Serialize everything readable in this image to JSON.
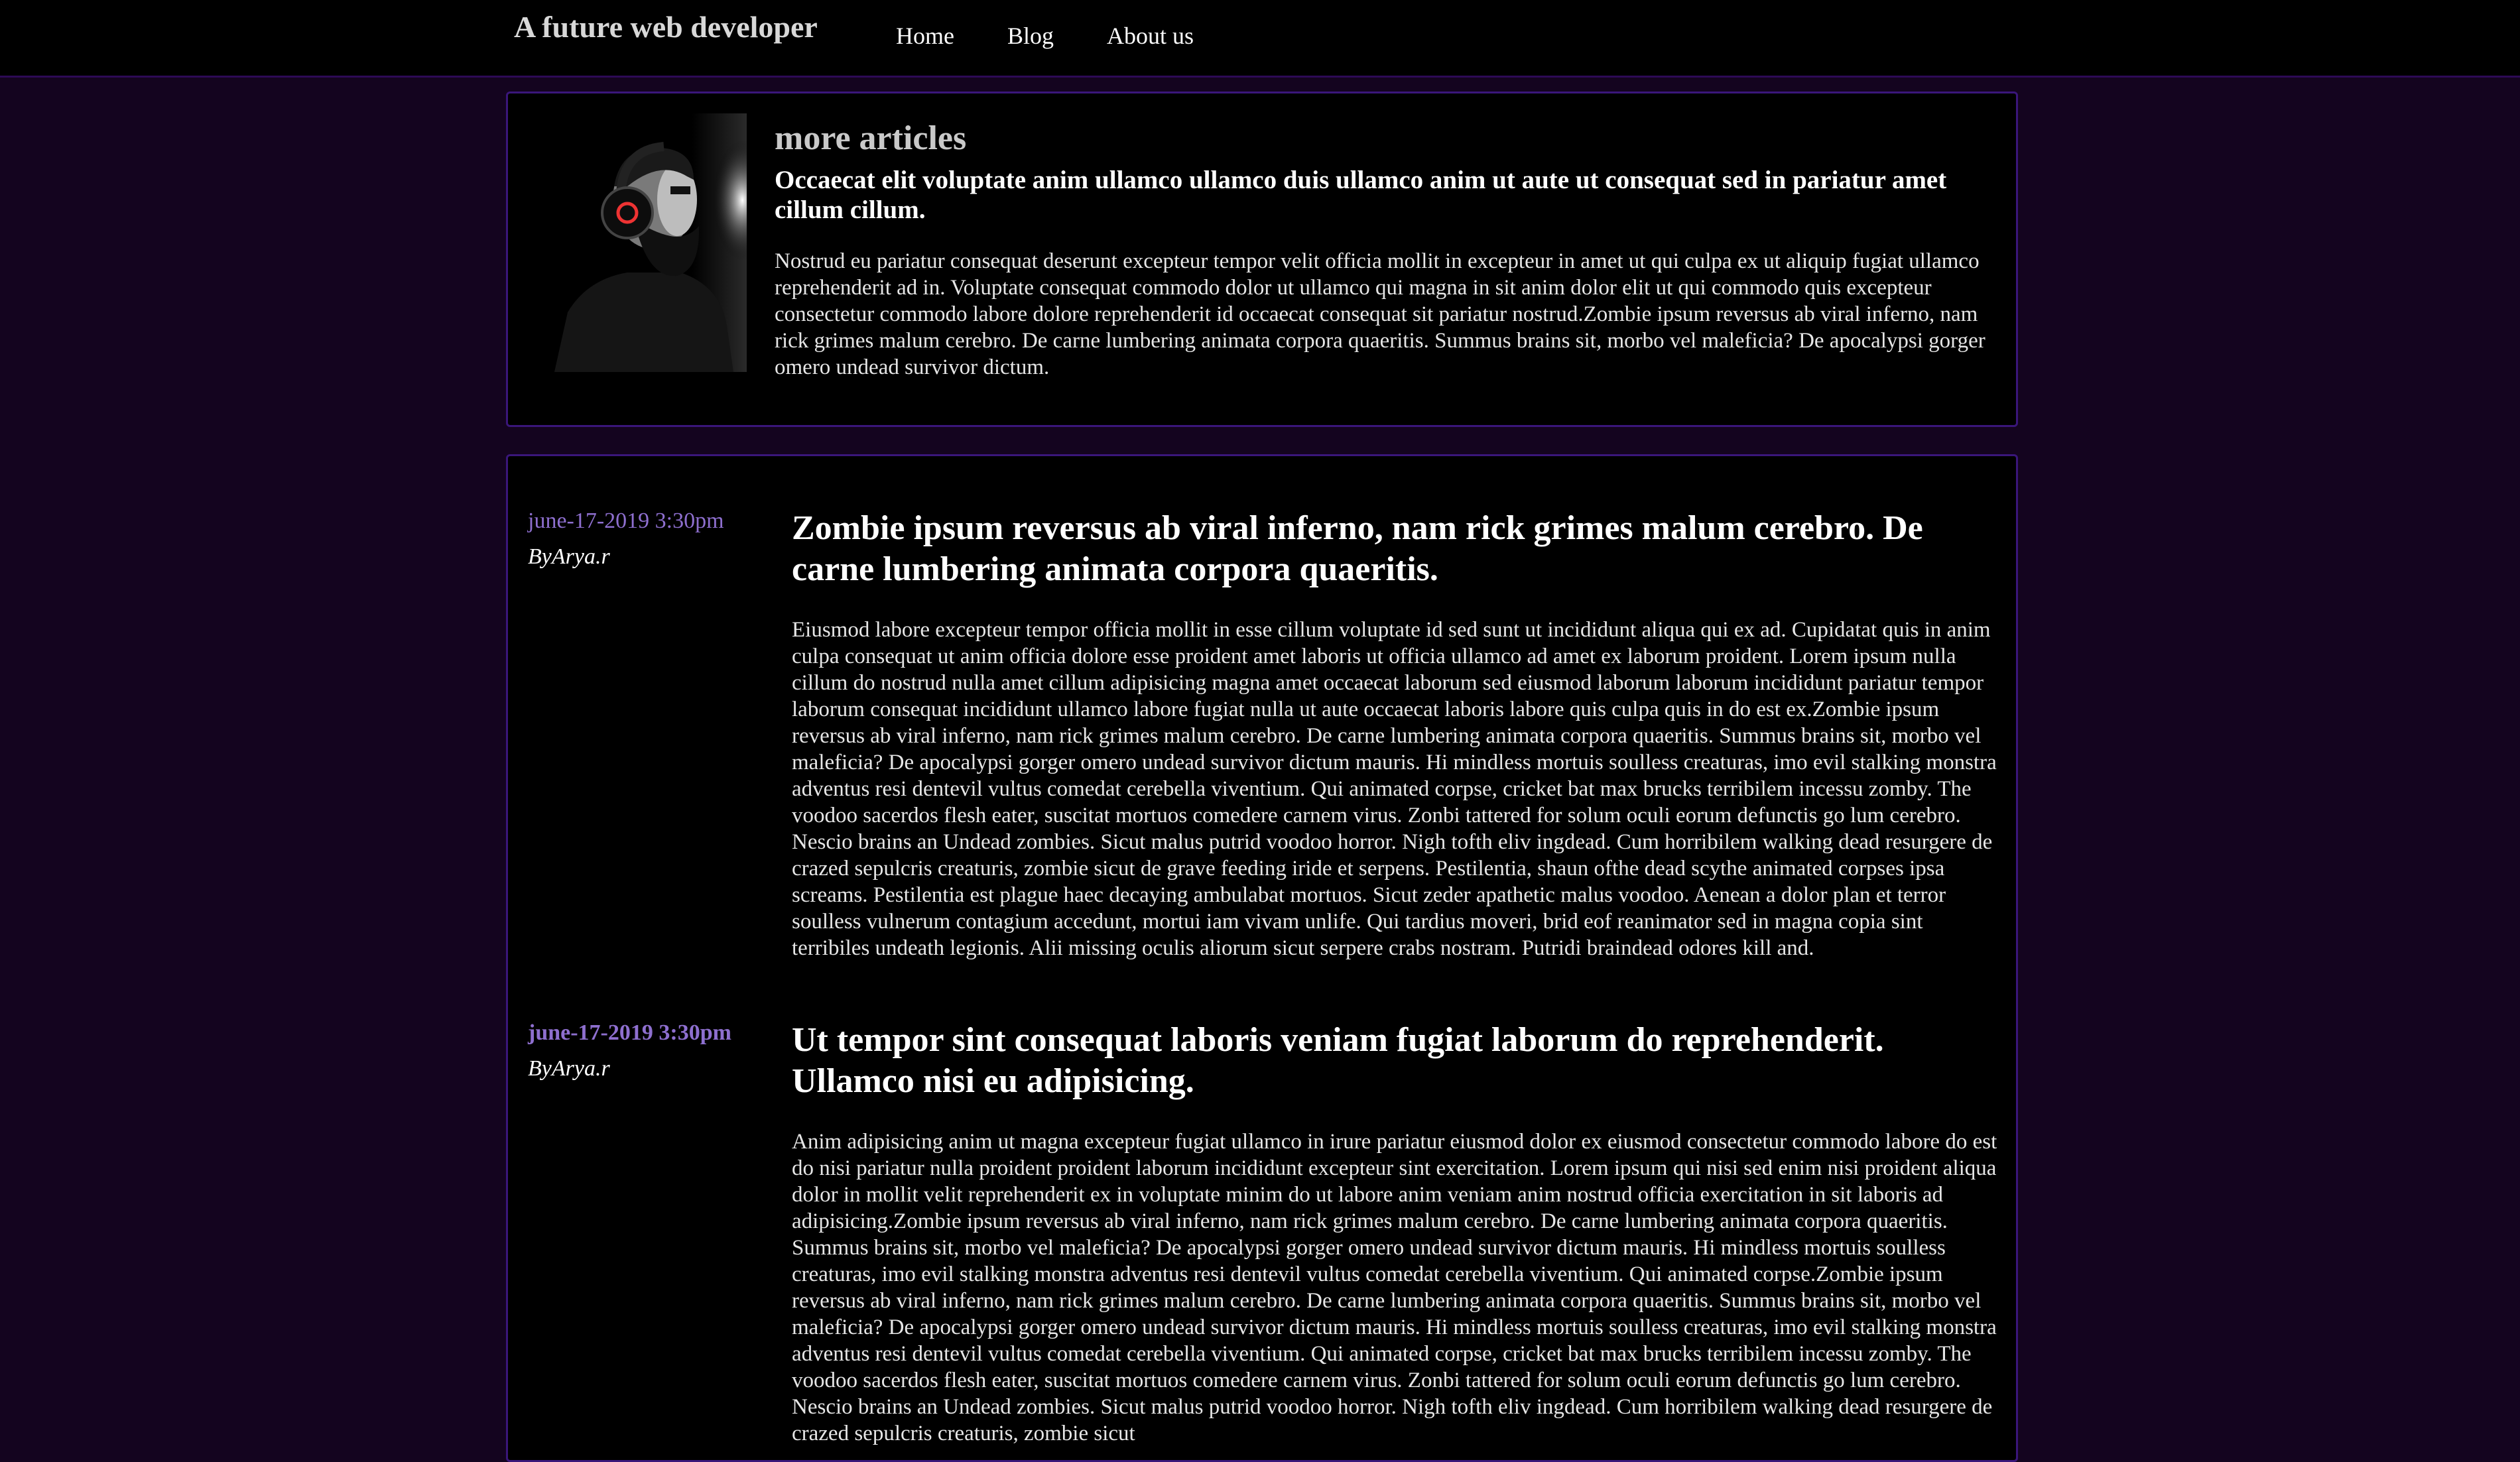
{
  "header": {
    "site_title": "A future web developer",
    "nav": [
      {
        "label": "Home"
      },
      {
        "label": "Blog"
      },
      {
        "label": "About us"
      }
    ]
  },
  "featured": {
    "avatar_icon": "person-with-headphones-photo",
    "heading": "more articles",
    "subheading": "Occaecat elit voluptate anim ullamco ullamco duis ullamco anim ut aute ut consequat sed in pariatur amet cillum cillum.",
    "body": "Nostrud eu pariatur consequat deserunt excepteur tempor velit officia mollit in excepteur in amet ut qui culpa ex ut aliquip fugiat ullamco reprehenderit ad in. Voluptate consequat commodo dolor ut ullamco qui magna in sit anim dolor elit ut qui commodo quis excepteur consectetur commodo labore dolore reprehenderit id occaecat consequat sit pariatur nostrud.Zombie ipsum reversus ab viral inferno, nam rick grimes malum cerebro. De carne lumbering animata corpora quaeritis. Summus brains sit, morbo vel maleficia? De apocalypsi gorger omero undead survivor dictum."
  },
  "articles": [
    {
      "date": "june-17-2019 3:30pm",
      "author": "ByArya.r",
      "title": "Zombie ipsum reversus ab viral inferno, nam rick grimes malum cerebro. De carne lumbering animata corpora quaeritis.",
      "body": "Eiusmod labore excepteur tempor officia mollit in esse cillum voluptate id sed sunt ut incididunt aliqua qui ex ad. Cupidatat quis in anim culpa consequat ut anim officia dolore esse proident amet laboris ut officia ullamco ad amet ex laborum proident. Lorem ipsum nulla cillum do nostrud nulla amet cillum adipisicing magna amet occaecat laborum sed eiusmod laborum laborum incididunt pariatur tempor laborum consequat incididunt ullamco labore fugiat nulla ut aute occaecat laboris labore quis culpa quis in do est ex.Zombie ipsum reversus ab viral inferno, nam rick grimes malum cerebro. De carne lumbering animata corpora quaeritis. Summus brains sit, morbo vel maleficia? De apocalypsi gorger omero undead survivor dictum mauris. Hi mindless mortuis soulless creaturas, imo evil stalking monstra adventus resi dentevil vultus comedat cerebella viventium. Qui animated corpse, cricket bat max brucks terribilem incessu zomby. The voodoo sacerdos flesh eater, suscitat mortuos comedere carnem virus. Zonbi tattered for solum oculi eorum defunctis go lum cerebro. Nescio brains an Undead zombies. Sicut malus putrid voodoo horror. Nigh tofth eliv ingdead. Cum horribilem walking dead resurgere de crazed sepulcris creaturis, zombie sicut de grave feeding iride et serpens. Pestilentia, shaun ofthe dead scythe animated corpses ipsa screams. Pestilentia est plague haec decaying ambulabat mortuos. Sicut zeder apathetic malus voodoo. Aenean a dolor plan et terror soulless vulnerum contagium accedunt, mortui iam vivam unlife. Qui tardius moveri, brid eof reanimator sed in magna copia sint terribiles undeath legionis. Alii missing oculis aliorum sicut serpere crabs nostram. Putridi braindead odores kill and."
    },
    {
      "date": "june-17-2019 3:30pm",
      "author": "ByArya.r",
      "title": "Ut tempor sint consequat laboris veniam fugiat laborum do reprehenderit. Ullamco nisi eu adipisicing.",
      "body": "Anim adipisicing anim ut magna excepteur fugiat ullamco in irure pariatur eiusmod dolor ex eiusmod consectetur commodo labore do est do nisi pariatur nulla proident proident laborum incididunt excepteur sint exercitation. Lorem ipsum qui nisi sed enim nisi proident aliqua dolor in mollit velit reprehenderit ex in voluptate minim do ut labore anim veniam anim nostrud officia exercitation in sit laboris ad adipisicing.Zombie ipsum reversus ab viral inferno, nam rick grimes malum cerebro. De carne lumbering animata corpora quaeritis. Summus brains sit, morbo vel maleficia? De apocalypsi gorger omero undead survivor dictum mauris. Hi mindless mortuis soulless creaturas, imo evil stalking monstra adventus resi dentevil vultus comedat cerebella viventium. Qui animated corpse.Zombie ipsum reversus ab viral inferno, nam rick grimes malum cerebro. De carne lumbering animata corpora quaeritis. Summus brains sit, morbo vel maleficia? De apocalypsi gorger omero undead survivor dictum mauris. Hi mindless mortuis soulless creaturas, imo evil stalking monstra adventus resi dentevil vultus comedat cerebella viventium. Qui animated corpse, cricket bat max brucks terribilem incessu zomby. The voodoo sacerdos flesh eater, suscitat mortuos comedere carnem virus. Zonbi tattered for solum oculi eorum defunctis go lum cerebro. Nescio brains an Undead zombies. Sicut malus putrid voodoo horror. Nigh tofth eliv ingdead. Cum horribilem walking dead resurgere de crazed sepulcris creaturis, zombie sicut"
    }
  ]
}
